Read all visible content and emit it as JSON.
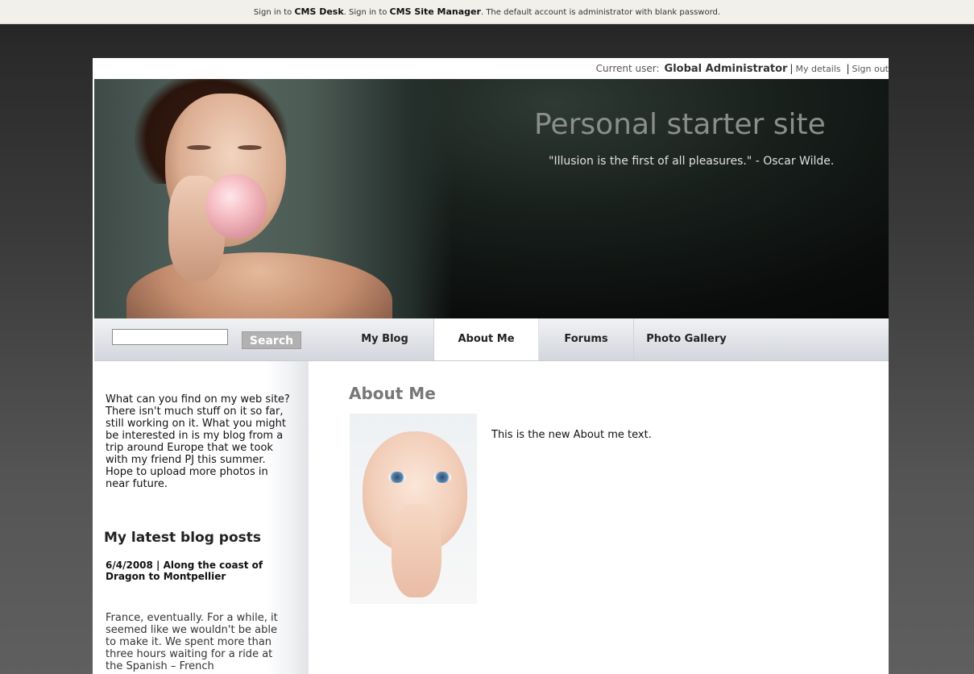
{
  "admin_bar": {
    "sign_in_label": "Sign in to",
    "cms_desk": "CMS Desk",
    "sign_in_label_2": "Sign in to",
    "site_manager": "CMS Site Manager",
    "default_account_note": "The default account is administrator with blank password."
  },
  "user_bar": {
    "current_user_label": "Current user:",
    "user_name": "Global Administrator",
    "my_details": "My details",
    "sign_out": "Sign out"
  },
  "header": {
    "title": "Personal starter site",
    "quote": "\"Illusion is the first of all pleasures.\" - Oscar Wilde."
  },
  "search": {
    "input_value": "",
    "button_label": "Search"
  },
  "menu": {
    "items": [
      {
        "label": "My Blog",
        "active": false
      },
      {
        "label": "About Me",
        "active": true
      },
      {
        "label": "Forums",
        "active": false
      },
      {
        "label": "Photo Gallery",
        "active": false
      }
    ]
  },
  "sidebar": {
    "intro": "What can you find on my web site? There isn't much stuff on it so far, still working on it. What you might be interested in is my blog from a trip around Europe that we took with my friend PJ this summer. Hope to upload more photos in near future.",
    "latest_heading": "My latest blog posts",
    "posts": [
      {
        "title": "6/4/2008 | Along the coast of Dragon to Montpellier",
        "excerpt": "France, eventually. For a while, it seemed like we wouldn't be able to make it. We spent more than three hours waiting for a ride at the Spanish – French"
      }
    ]
  },
  "content": {
    "heading": "About Me",
    "body_text": "This is the new About me text."
  },
  "colors": {
    "page_bg": "#2a2a2a",
    "nav_bg": "#e3e5e9",
    "title_gray": "#8a8f8b",
    "heading_gray": "#777777"
  }
}
